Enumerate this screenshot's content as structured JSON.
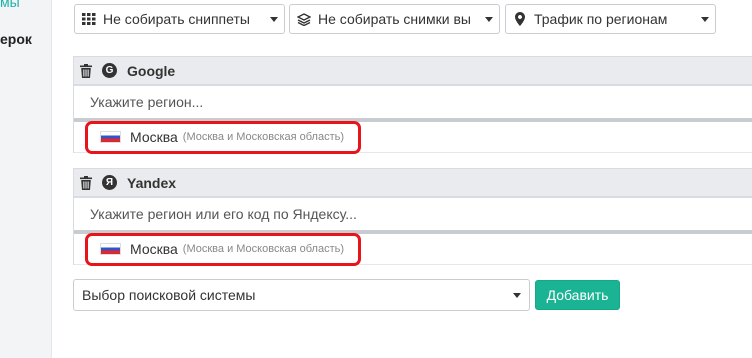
{
  "sidebar": {
    "fragment_top": "мы",
    "fragment_mid": "ерок"
  },
  "toolbar": {
    "snippets": {
      "icon": "grid-icon",
      "label": "Не собирать сниппеты"
    },
    "screenshots": {
      "icon": "layers-icon",
      "label": "Не собирать снимки вы"
    },
    "traffic": {
      "icon": "map-marker-icon",
      "label": "Трафик по регионам"
    }
  },
  "engines": [
    {
      "name": "Google",
      "logo_letter": "G",
      "search_placeholder": "Укажите регион...",
      "region": {
        "name": "Москва",
        "detail": "(Москва и Московская область)"
      }
    },
    {
      "name": "Yandex",
      "logo_letter": "Я",
      "search_placeholder": "Укажите регион или его код по Яндексу...",
      "region": {
        "name": "Москва",
        "detail": "(Москва и Московская область)"
      }
    }
  ],
  "footer": {
    "engine_select": "Выбор поисковой системы",
    "add_button": "Добавить"
  },
  "colors": {
    "accent": "#1ab394",
    "highlight": "#e8141c",
    "header_bg": "#e9ebee"
  }
}
